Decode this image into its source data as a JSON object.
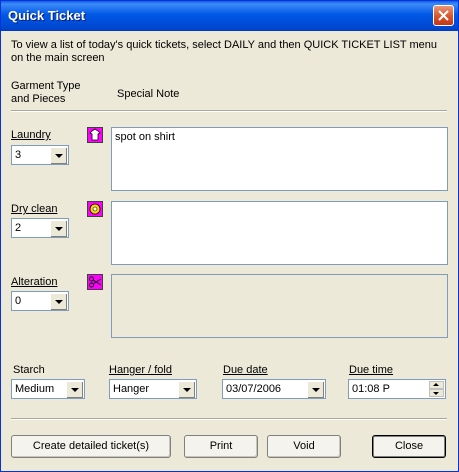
{
  "window": {
    "title": "Quick Ticket"
  },
  "instructions": "To view a list of today's quick tickets, select DAILY and then QUICK TICKET LIST menu on the main screen",
  "headers": {
    "garment": "Garment Type\nand Pieces",
    "note": "Special Note"
  },
  "rows": [
    {
      "label": "Laundry",
      "value": "3",
      "note": "spot on shirt",
      "icon": "shirt-icon"
    },
    {
      "label": "Dry clean",
      "value": "2",
      "note": "",
      "icon": "hanger-icon"
    },
    {
      "label": "Alteration",
      "value": "0",
      "note": "",
      "icon": "scissors-icon"
    }
  ],
  "options": {
    "starch": {
      "label": "Starch",
      "value": "Medium"
    },
    "hanger": {
      "label": "Hanger / fold",
      "value": "Hanger"
    },
    "due_date": {
      "label": "Due date",
      "value": "03/07/2006"
    },
    "due_time": {
      "label": "Due time",
      "value": "01:08 P"
    }
  },
  "buttons": {
    "create": "Create detailed ticket(s)",
    "print": "Print",
    "void": "Void",
    "close": "Close"
  },
  "colors": {
    "titlebar": "#0054e3",
    "face": "#ece9d8",
    "icon_bg": "#ff00ff"
  }
}
